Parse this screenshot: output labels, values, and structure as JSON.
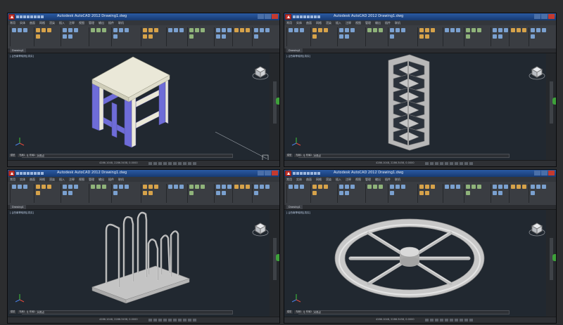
{
  "app": {
    "title": "Autodesk AutoCAD 2012  Drawing1.dwg",
    "menus": [
      "常用",
      "实体",
      "曲面",
      "网格",
      "渲染",
      "插入",
      "注释",
      "视图",
      "管理",
      "输出",
      "插件",
      "联机"
    ],
    "drawing_tab": "Drawing1",
    "view_label": "[-][西南等轴测][真实]",
    "command_prompt": "命令： 指定对角点",
    "coords": "4286.1048, 2286.3458, 0.0000",
    "layout_tabs": [
      "模型",
      "布局1",
      "布局2"
    ],
    "colors": {
      "titlebar": "#1a3f7a",
      "canvas": "#212830",
      "ribbon": "#3a3d42",
      "model_light": "#eae8d8",
      "model_side": "#6e6cd8",
      "model_grey": "#c8c8c8"
    }
  },
  "viewports": [
    {
      "model": "stool"
    },
    {
      "model": "lattice-column"
    },
    {
      "model": "bent-rod-rack"
    },
    {
      "model": "wheel"
    }
  ]
}
